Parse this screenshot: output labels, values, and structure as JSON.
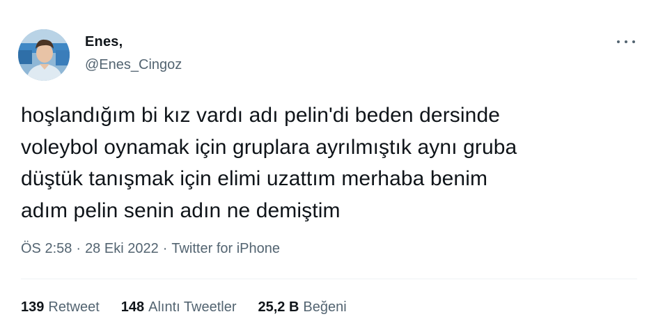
{
  "user": {
    "display_name": "Enes,",
    "handle": "@Enes_Cingoz",
    "avatar_icon": "profile-photo"
  },
  "tweet": {
    "text": "hoşlandığım bi kız vardı adı pelin'di beden dersinde\nvoleybol oynamak için gruplara ayrılmıştık aynı gruba\ndüştük tanışmak için elimi uzattım merhaba benim\nadım pelin senin adın ne demiştim",
    "time": "ÖS 2:58",
    "date": "28 Eki 2022",
    "source": "Twitter for iPhone",
    "separator": "·"
  },
  "stats": {
    "retweets_count": "139",
    "retweets_label": "Retweet",
    "quotes_count": "148",
    "quotes_label": "Alıntı Tweetler",
    "likes_count": "25,2 B",
    "likes_label": "Beğeni"
  },
  "colors": {
    "text_primary": "#0f1419",
    "text_secondary": "#536471",
    "divider": "#eff3f4"
  },
  "icons": {
    "more": "more-horizontal-icon"
  }
}
